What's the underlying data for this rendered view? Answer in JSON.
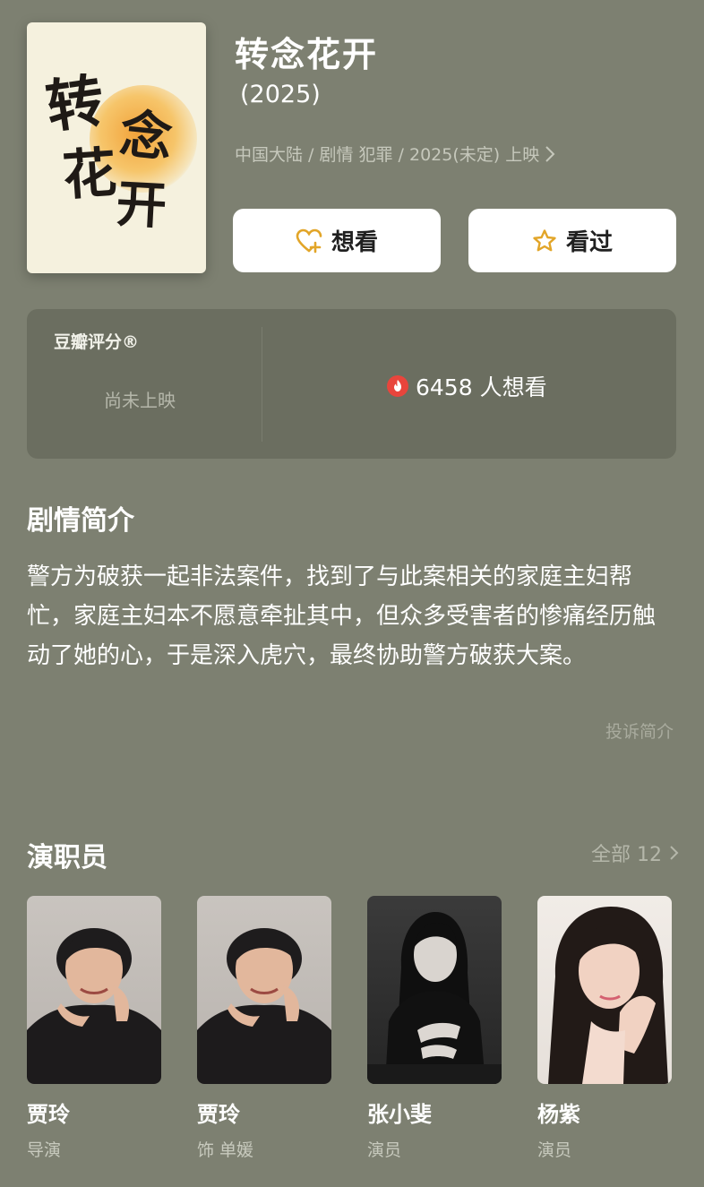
{
  "movie": {
    "poster_text": [
      "转",
      "念",
      "花",
      "开"
    ],
    "title": "转念花开",
    "year": "(2025)",
    "meta": "中国大陆 / 剧情 犯罪 / 2025(未定) 上映"
  },
  "actions": {
    "want_label": "想看",
    "seen_label": "看过"
  },
  "rating": {
    "label": "豆瓣评分®",
    "status": "尚未上映",
    "wish_count": "6458 人想看"
  },
  "synopsis": {
    "heading": "剧情简介",
    "text": "警方为破获一起非法案件，找到了与此案相关的家庭主妇帮忙，家庭主妇本不愿意牵扯其中，但众多受害者的惨痛经历触动了她的心，于是深入虎穴，最终协助警方破获大案。",
    "complain_label": "投诉简介"
  },
  "cast": {
    "heading": "演职员",
    "all_label": "全部 12",
    "members": [
      {
        "name": "贾玲",
        "role": "导演"
      },
      {
        "name": "贾玲",
        "role": "饰 单媛"
      },
      {
        "name": "张小斐",
        "role": "演员"
      },
      {
        "name": "杨紫",
        "role": "演员"
      }
    ]
  },
  "colors": {
    "background": "#7d8071",
    "panel": "#6b6e60",
    "accent_gold": "#e2a528",
    "hot_red": "#e8453c"
  }
}
